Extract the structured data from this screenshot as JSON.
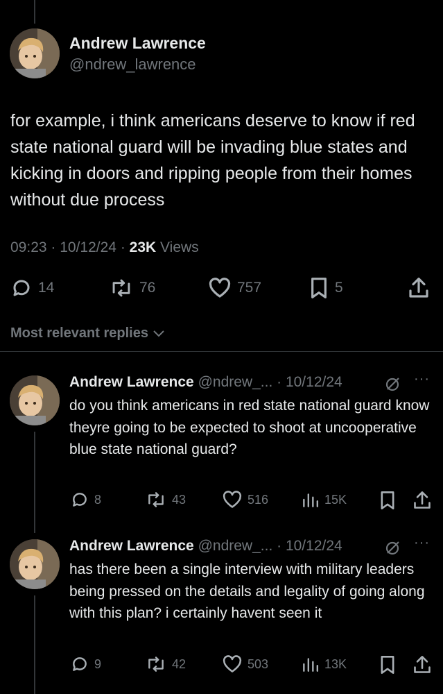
{
  "main_post": {
    "author_name": "Andrew Lawrence",
    "author_handle": "@ndrew_lawrence",
    "text": "for example, i think americans deserve to know if red state national guard will be invading blue states and kicking in doors and ripping people from their homes without due process",
    "time": "09:23",
    "date": "10/12/24",
    "views_count": "23K",
    "views_label": "Views",
    "replies": "14",
    "reposts": "76",
    "likes": "757",
    "bookmarks": "5"
  },
  "replies_filter": {
    "label": "Most relevant replies"
  },
  "replies": [
    {
      "author_name": "Andrew Lawrence",
      "author_handle": "@ndrew_...",
      "date": "10/12/24",
      "text": "do you think americans in red state national guard know theyre going to be expected to shoot at uncooperative blue state national guard?",
      "replies": "8",
      "reposts": "43",
      "likes": "516",
      "views": "15K"
    },
    {
      "author_name": "Andrew Lawrence",
      "author_handle": "@ndrew_...",
      "date": "10/12/24",
      "text": "has there been a single interview with military leaders being pressed on the details and legality of going along with this plan? i certainly havent seen it",
      "replies": "9",
      "reposts": "42",
      "likes": "503",
      "views": "13K"
    }
  ],
  "colors": {
    "background": "#000000",
    "text": "#e7e9ea",
    "muted": "#71767b",
    "divider": "#2f3336"
  },
  "icons": [
    "reply-icon",
    "repost-icon",
    "like-icon",
    "bookmark-icon",
    "share-icon",
    "views-icon",
    "grok-icon",
    "more-icon",
    "chevron-down-icon"
  ]
}
